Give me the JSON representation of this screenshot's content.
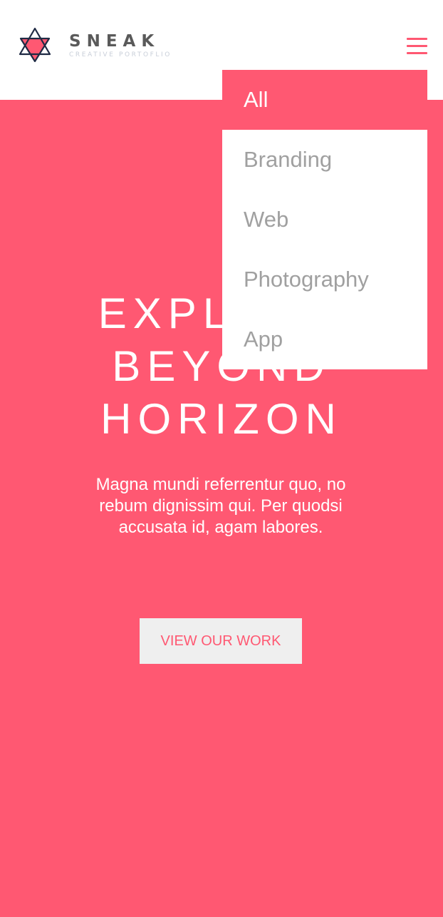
{
  "brand": {
    "name": "SNEAK",
    "tagline": "CREATIVE PORTOFLIO",
    "logo_icon": "star-triangle-logo-icon",
    "accent_color": "#ff5872",
    "dark_color": "#1f2a44"
  },
  "nav": {
    "menu_icon": "hamburger-menu-icon"
  },
  "filter_menu": {
    "items": [
      {
        "label": "All",
        "active": true
      },
      {
        "label": "Branding",
        "active": false
      },
      {
        "label": "Web",
        "active": false
      },
      {
        "label": "Photography",
        "active": false
      },
      {
        "label": "App",
        "active": false
      }
    ]
  },
  "hero": {
    "title_lines": [
      "EXPLORE",
      "BEYOND",
      "HORIZON"
    ],
    "description": "Magna mundi referrentur quo, no rebum dignissim qui. Per quodsi accusata id, agam labores.",
    "cta_label": "VIEW OUR WORK",
    "background_color": "#ff5872"
  }
}
